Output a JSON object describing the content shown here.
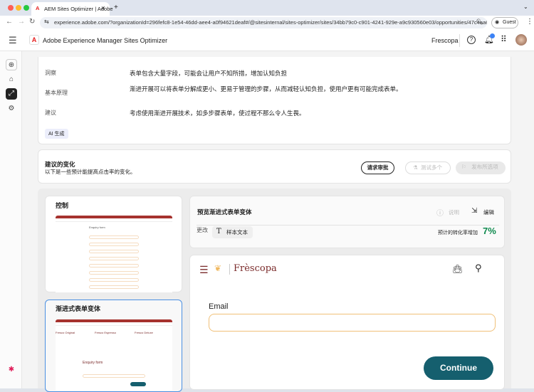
{
  "browser": {
    "tab_title": "AEM Sites Optimizer | Adobe",
    "new_tab": "+",
    "url": "experience.adobe.com/?organizationId=296fefc8-1e54-46dd-aee4-a0f94621deaf#/@sitesinternal/sites-optimizer/sites/34bb79c0-c901-4241-929e-a9c930560e03/opportunities/47c4aa6...",
    "profile": "Guest"
  },
  "app": {
    "title": "Adobe Experience Manager Sites Optimizer",
    "org": "Frescopa"
  },
  "insight": {
    "rows": [
      {
        "label": "洞察",
        "text": "表单包含大量字段，可能会让用户不知所措，增加认知负担"
      },
      {
        "label": "基本原理",
        "text": "渐进开展可以将表单分解成更小、更易于管理的步骤，从而减轻认知负担，使用户更有可能完成表单。"
      },
      {
        "label": "建议",
        "text": "考虑使用渐进开展技术，如多步骤表单，使过程不那么令人生畏。"
      }
    ],
    "badge": "AI 生成"
  },
  "changes": {
    "title": "建议的变化",
    "subtitle": "以下是一些预计能提高点击率的变化。",
    "request": "请求审批",
    "test": "测试多个",
    "publish": "发布所选项"
  },
  "variants": {
    "control": "控制",
    "progressive": "渐进式表单变体",
    "mini_form_title": "Enquiry form",
    "mini_products": [
      "Fresco Original",
      "Fresco Espresso",
      "Fresco Deluxe"
    ]
  },
  "preview": {
    "title": "预览渐进式表单变体",
    "explain": "说明",
    "edit": "编辑",
    "change_label": "更改",
    "change_chip": "样本文本",
    "uplift_label": "预计的转化率增加",
    "uplift_value": "7%",
    "uplift_color": "#0e8a4e",
    "brand": "Frèscopa",
    "email_label": "Email",
    "continue": "Continue",
    "continue_color": "#155f6e"
  }
}
